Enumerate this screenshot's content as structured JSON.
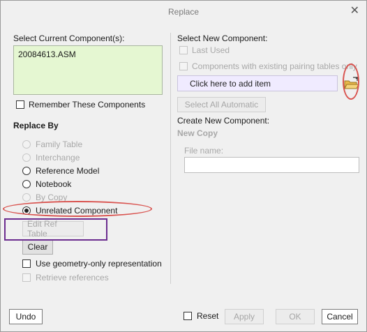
{
  "window": {
    "title": "Replace",
    "close_glyph": "✕"
  },
  "left": {
    "select_current_label": "Select Current Component(s):",
    "current_items": [
      "20084613.ASM"
    ],
    "remember_label": "Remember These Components",
    "remember_checked": false,
    "replace_by_label": "Replace By",
    "options": [
      {
        "label": "Family Table",
        "enabled": false,
        "selected": false
      },
      {
        "label": "Interchange",
        "enabled": false,
        "selected": false
      },
      {
        "label": "Reference Model",
        "enabled": true,
        "selected": false
      },
      {
        "label": "Notebook",
        "enabled": true,
        "selected": false
      },
      {
        "label": "By Copy",
        "enabled": false,
        "selected": false
      },
      {
        "label": "Unrelated Component",
        "enabled": true,
        "selected": true
      }
    ],
    "edit_ref_table_label": "Edit Ref Table",
    "clear_label": "Clear",
    "geometry_only_label": "Use geometry-only representation",
    "retrieve_refs_label": "Retrieve references"
  },
  "right": {
    "select_new_label": "Select New Component:",
    "last_used_label": "Last Used",
    "pairing_tables_label": "Components with existing pairing tables only",
    "add_item_placeholder": "Click here to add item",
    "open_icon": "folder-open-icon",
    "select_all_label": "Select All Automatic",
    "create_new_label": "Create New Component:",
    "new_copy_label": "New Copy",
    "file_name_label": "File name:",
    "file_name_value": ""
  },
  "footer": {
    "undo_label": "Undo",
    "reset_label": "Reset",
    "apply_label": "Apply",
    "ok_label": "OK",
    "cancel_label": "Cancel"
  },
  "colors": {
    "annotation_red": "#d9534f",
    "annotation_purple": "#6b2c8f",
    "list_bg": "#e5f7d2",
    "add_item_bg": "#f0ebff"
  }
}
